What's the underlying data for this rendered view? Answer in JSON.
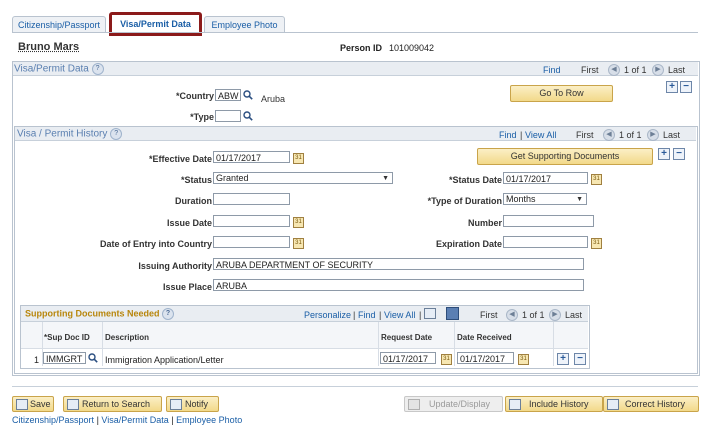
{
  "tabs": [
    "Citizenship/Passport",
    "Visa/Permit Data",
    "Employee Photo"
  ],
  "person": {
    "name": "Bruno Mars",
    "id_label": "Person ID",
    "id_value": "101009042"
  },
  "visa_section": {
    "title": "Visa/Permit Data",
    "find": "Find",
    "first": "First",
    "pager": "1 of 1",
    "last": "Last",
    "country_label": "*Country",
    "country_value": "ABW",
    "country_desc": "Aruba",
    "type_label": "*Type",
    "type_value": "",
    "goto_row": "Go To Row"
  },
  "history": {
    "title": "Visa / Permit History",
    "find": "Find",
    "view_all": "View All",
    "first": "First",
    "pager": "1 of 1",
    "last": "Last",
    "get_docs": "Get Supporting Documents",
    "effective_date_label": "*Effective Date",
    "effective_date": "01/17/2017",
    "status_label": "*Status",
    "status_value": "Granted",
    "status_date_label": "*Status Date",
    "status_date": "01/17/2017",
    "duration_label": "Duration",
    "duration_value": "",
    "type_duration_label": "*Type of Duration",
    "type_duration_value": "Months",
    "issue_date_label": "Issue Date",
    "issue_date": "",
    "number_label": "Number",
    "number_value": "",
    "entry_date_label": "Date of Entry into Country",
    "entry_date": "",
    "expiration_label": "Expiration Date",
    "expiration_date": "",
    "authority_label": "Issuing Authority",
    "authority_value": "ARUBA DEPARTMENT OF SECURITY",
    "issue_place_label": "Issue Place",
    "issue_place_value": "ARUBA"
  },
  "docs": {
    "title": "Supporting Documents Needed",
    "personalize": "Personalize",
    "find": "Find",
    "view_all": "View All",
    "first": "First",
    "pager": "1 of 1",
    "last": "Last",
    "columns": [
      "*Sup Doc ID",
      "Description",
      "Request Date",
      "Date Received"
    ],
    "rows": [
      {
        "num": "1",
        "doc_id": "IMMGRT",
        "description": "Immigration Application/Letter",
        "request_date": "01/17/2017",
        "date_received": "01/17/2017"
      }
    ]
  },
  "toolbar": {
    "save": "Save",
    "return_search": "Return to Search",
    "notify": "Notify",
    "update_display": "Update/Display",
    "include_history": "Include History",
    "correct_history": "Correct History"
  },
  "footer_links": [
    "Citizenship/Passport",
    "Visa/Permit Data",
    "Employee Photo"
  ],
  "footer_sep": "|"
}
